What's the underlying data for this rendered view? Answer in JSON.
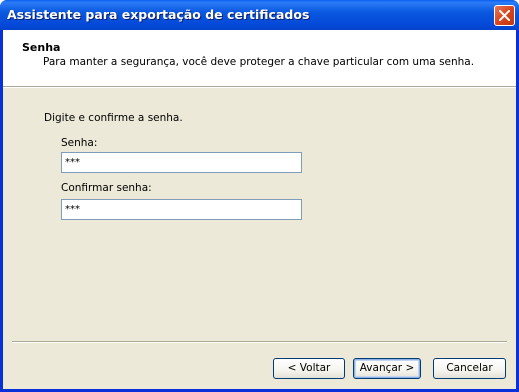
{
  "window": {
    "title": "Assistente para exportação de certificados"
  },
  "header": {
    "title": "Senha",
    "subtitle": "Para manter a segurança, você deve proteger a chave particular com uma senha."
  },
  "form": {
    "instruction": "Digite e confirme a senha.",
    "password_label": "Senha:",
    "password_value": "***",
    "confirm_label": "Confirmar senha:",
    "confirm_value": "***"
  },
  "buttons": {
    "back": "< Voltar",
    "next": "Avançar >",
    "cancel": "Cancelar"
  },
  "colors": {
    "titlebar": "#0a58e0",
    "dialog_bg": "#ece9d8",
    "close_button": "#d8441e"
  }
}
